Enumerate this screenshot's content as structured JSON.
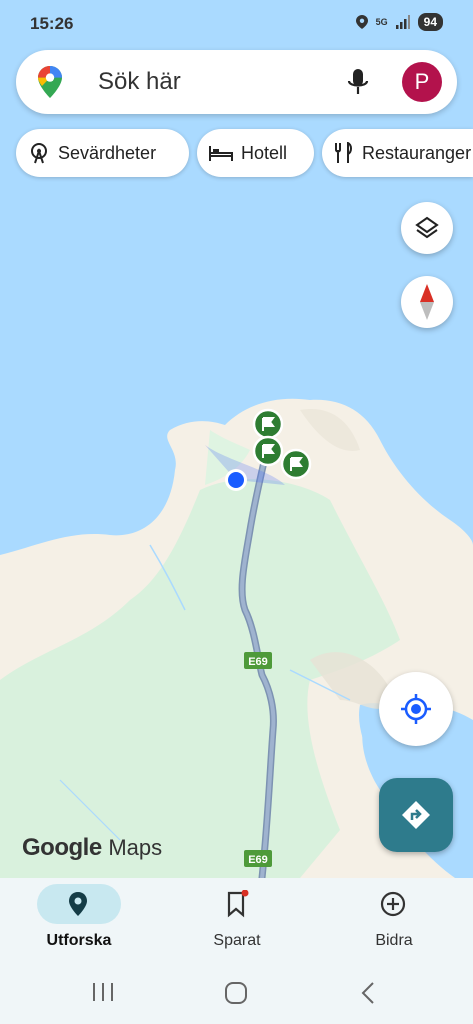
{
  "status_bar": {
    "time": "15:26",
    "network": "5G",
    "battery": "94"
  },
  "search": {
    "placeholder": "Sök här",
    "avatar_letter": "P"
  },
  "chips": [
    {
      "label": "Sevärdheter",
      "icon": "ferris-wheel-icon"
    },
    {
      "label": "Hotell",
      "icon": "bed-icon"
    },
    {
      "label": "Restauranger",
      "icon": "fork-knife-icon"
    }
  ],
  "map": {
    "road_labels": [
      "E69",
      "E69"
    ],
    "brand": {
      "google": "Google",
      "maps": "Maps"
    },
    "colors": {
      "water": "#aadaff",
      "land": "#f5f0e6",
      "park": "#d9f1dd",
      "road": "#8fa6c4",
      "marker": "#2e7d32"
    }
  },
  "nav": [
    {
      "label": "Utforska",
      "icon": "explore-pin-icon",
      "active": true
    },
    {
      "label": "Sparat",
      "icon": "bookmark-icon",
      "active": false
    },
    {
      "label": "Bidra",
      "icon": "add-circle-icon",
      "active": false
    }
  ]
}
